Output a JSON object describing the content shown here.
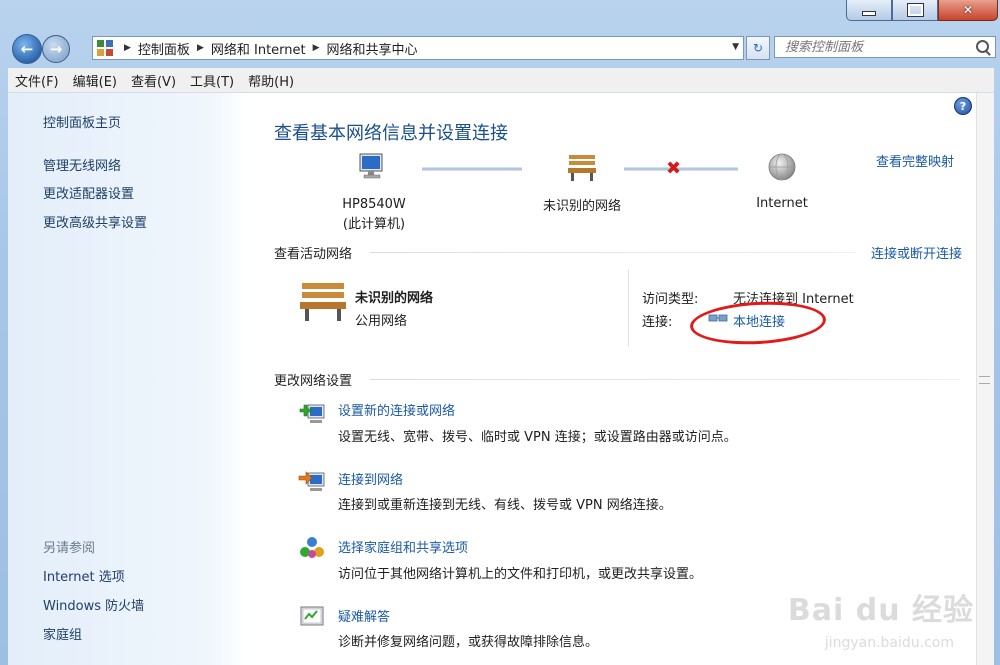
{
  "window": {
    "address": {
      "crumbs": [
        "控制面板",
        "网络和 Internet",
        "网络和共享中心"
      ]
    },
    "search_placeholder": "搜索控制面板"
  },
  "menubar": [
    "文件(F)",
    "编辑(E)",
    "查看(V)",
    "工具(T)",
    "帮助(H)"
  ],
  "sidebar": {
    "home": "控制面板主页",
    "items": [
      "管理无线网络",
      "更改适配器设置",
      "更改高级共享设置"
    ],
    "see_also_title": "另请参阅",
    "see_also": [
      "Internet 选项",
      "Windows 防火墙",
      "家庭组"
    ]
  },
  "main": {
    "title": "查看基本网络信息并设置连接",
    "full_map": "查看完整映射",
    "map": {
      "computer_name": "HP8540W",
      "computer_sub": "(此计算机)",
      "network": "未识别的网络",
      "internet": "Internet"
    },
    "active": {
      "section": "查看活动网络",
      "connect_link": "连接或断开连接",
      "network_name": "未识别的网络",
      "network_type": "公用网络",
      "access_label": "访问类型:",
      "access_value": "无法连接到 Internet",
      "conn_label": "连接:",
      "conn_value": "本地连接"
    },
    "change": {
      "section": "更改网络设置",
      "tasks": [
        {
          "title": "设置新的连接或网络",
          "desc": "设置无线、宽带、拨号、临时或 VPN 连接；或设置路由器或访问点。"
        },
        {
          "title": "连接到网络",
          "desc": "连接到或重新连接到无线、有线、拨号或 VPN 网络连接。"
        },
        {
          "title": "选择家庭组和共享选项",
          "desc": "访问位于其他网络计算机上的文件和打印机，或更改共享设置。"
        },
        {
          "title": "疑难解答",
          "desc": "诊断并修复网络问题，或获得故障排除信息。"
        }
      ]
    }
  },
  "watermark": {
    "main": "Bai du 经验",
    "sub": "jingyan.baidu.com"
  },
  "colors": {
    "link": "#1a5aa6",
    "title": "#1a4f8f",
    "annotation": "#e01b1b"
  }
}
